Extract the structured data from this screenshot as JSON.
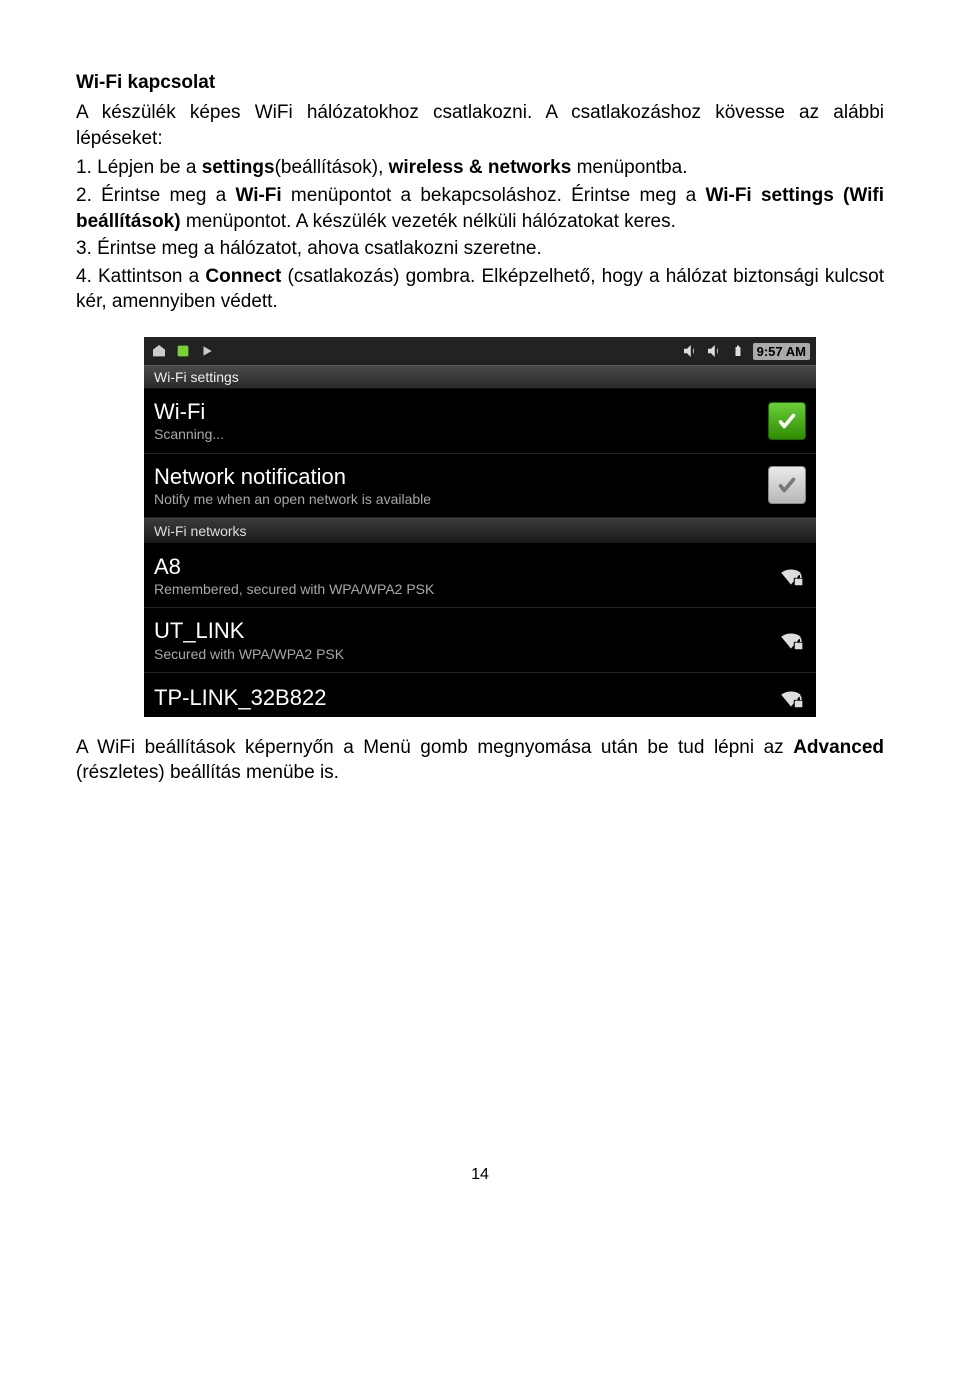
{
  "heading": "Wi-Fi kapcsolat",
  "intro": "A készülék képes WiFi hálózatokhoz csatlakozni. A csatlakozáshoz kövesse az alábbi lépéseket:",
  "steps": {
    "s1_a": "1. Lépjen be a ",
    "s1_b": "settings",
    "s1_c": "(beállítások), ",
    "s1_d": "wireless & networks",
    "s1_e": " menüpontba.",
    "s2_a": "2. Érintse meg a ",
    "s2_b": "Wi-Fi",
    "s2_c": " menüpontot a bekapcsoláshoz. Érintse meg a ",
    "s2_d": "Wi-Fi settings (Wifi beállítások)",
    "s2_e": " menüpontot. A készülék vezeték nélküli hálózatokat keres.",
    "s3": "3. Érintse meg a hálózatot, ahova csatlakozni szeretne.",
    "s4_a": "4. Kattintson a ",
    "s4_b": "Connect",
    "s4_c": " (csatlakozás) gombra. Elképzelhető, hogy a hálózat biztonsági kulcsot kér, amennyiben védett."
  },
  "after_a": "A WiFi beállítások képernyőn a Menü gomb megnyomása után be tud lépni az ",
  "after_b": "Advanced",
  "after_c": " (részletes) beállítás menübe is.",
  "page_number": "14",
  "device": {
    "time": "9:57 AM",
    "screen_title": "Wi-Fi settings",
    "item_wifi": {
      "title": "Wi-Fi",
      "subtitle": "Scanning..."
    },
    "item_notify": {
      "title": "Network notification",
      "subtitle": "Notify me when an open network is available"
    },
    "section_networks": "Wi-Fi networks",
    "net1": {
      "title": "A8",
      "subtitle": "Remembered, secured with WPA/WPA2 PSK"
    },
    "net2": {
      "title": "UT_LINK",
      "subtitle": "Secured with WPA/WPA2 PSK"
    },
    "net3": {
      "title": "TP-LINK_32B822",
      "subtitle": ""
    }
  }
}
